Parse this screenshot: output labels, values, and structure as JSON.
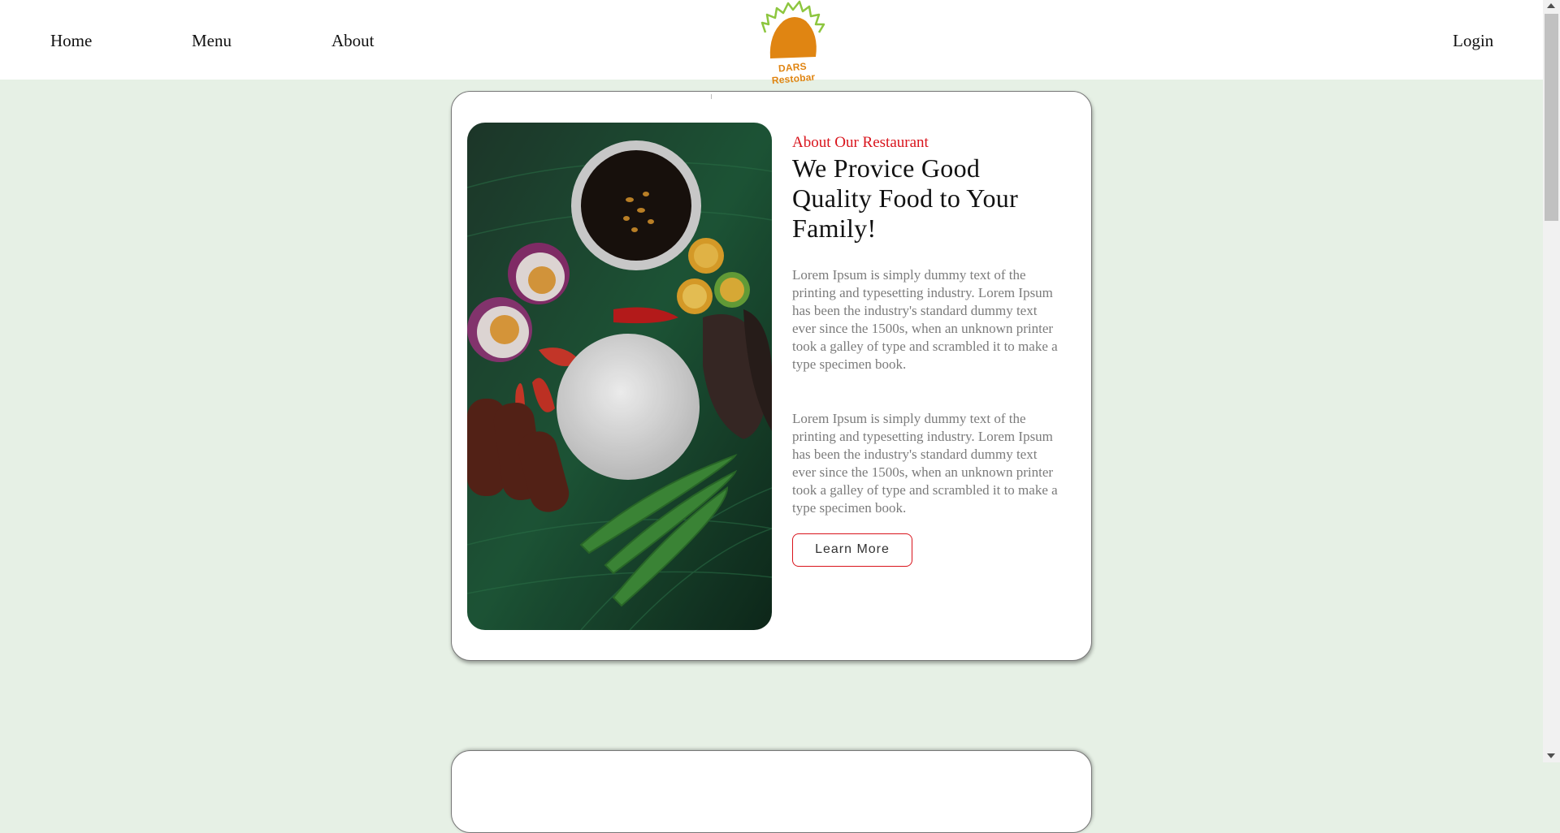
{
  "nav": {
    "home": "Home",
    "menu": "Menu",
    "about": "About",
    "login": "Login",
    "logo_text": "DARS Restobar"
  },
  "about": {
    "eyebrow": "About Our Restaurant",
    "headline": "We Provice Good Quality Food to Your Family!",
    "paragraph_1": "Lorem Ipsum is simply dummy text of the printing and typesetting industry. Lorem Ipsum has been the industry's standard dummy text ever since the 1500s, when an unknown printer took a galley of type and scrambled it to make a type specimen book.",
    "paragraph_2": "Lorem Ipsum is simply dummy text of the printing and typesetting industry. Lorem Ipsum has been the industry's standard dummy text ever since the 1500s, when an unknown printer took a galley of type and scrambled it to make a type specimen book.",
    "button_label": "Learn More"
  },
  "colors": {
    "page_background": "#e6f0e5",
    "accent_red": "#d9141c",
    "logo_orange": "#e08512",
    "logo_green": "#8dc63f"
  }
}
